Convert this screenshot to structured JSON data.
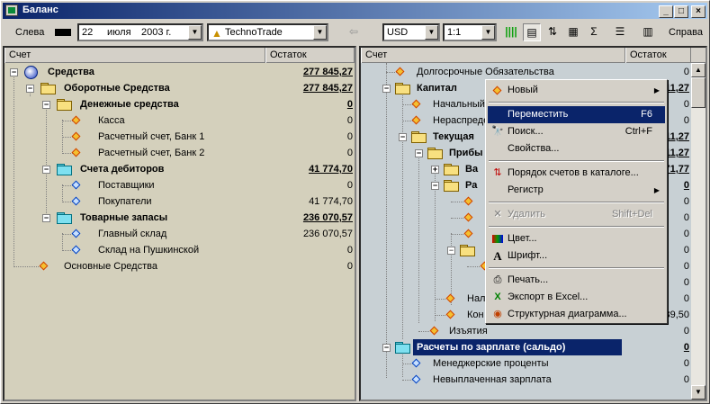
{
  "window": {
    "title": "Баланс"
  },
  "toolbar": {
    "left_label": "Слева",
    "right_label": "Справа",
    "date_day": "22",
    "date_month": "июля",
    "date_year": "2003 г.",
    "company": "TechnoTrade",
    "currency": "USD",
    "scale": "1:1",
    "back_arrow": "⇦"
  },
  "left": {
    "col_account": "Счет",
    "col_balance": "Остаток",
    "rows": [
      {
        "label": "Средства",
        "amount": "277 845,27"
      },
      {
        "label": "Оборотные Средства",
        "amount": "277 845,27"
      },
      {
        "label": "Денежные средства",
        "amount": "0"
      },
      {
        "label": "Касса",
        "amount": "0"
      },
      {
        "label": "Расчетный счет, Банк 1",
        "amount": "0"
      },
      {
        "label": "Расчетный счет, Банк 2",
        "amount": "0"
      },
      {
        "label": "Счета дебиторов",
        "amount": "41 774,70"
      },
      {
        "label": "Поставщики",
        "amount": "0"
      },
      {
        "label": "Покупатели",
        "amount": "41 774,70"
      },
      {
        "label": "Товарные запасы",
        "amount": "236 070,57"
      },
      {
        "label": "Главный склад",
        "amount": "236 070,57"
      },
      {
        "label": "Склад на Пушкинской",
        "amount": "0"
      },
      {
        "label": "Основные Средства",
        "amount": "0"
      }
    ]
  },
  "right": {
    "col_account": "Счет",
    "col_balance": "Остаток",
    "rows": [
      {
        "label": "Долгосрочные Обязательства",
        "amount": "0"
      },
      {
        "label": "Капитал",
        "amount": "11,27"
      },
      {
        "label": "Начальный",
        "amount": "0"
      },
      {
        "label": "Нераспреде",
        "amount": "0"
      },
      {
        "label": "Текущая",
        "amount": "11,27"
      },
      {
        "label": "Прибы",
        "amount": "11,27"
      },
      {
        "label": "Ва",
        "amount": "71,77"
      },
      {
        "label": "Ра",
        "amount": "0"
      },
      {
        "label": "",
        "amount": "0"
      },
      {
        "label": "",
        "amount": "0"
      },
      {
        "label": "",
        "amount": "0"
      },
      {
        "label": "",
        "amount": "0"
      },
      {
        "label": "",
        "amount": "0"
      },
      {
        "label": "",
        "amount": "0"
      },
      {
        "label": "Нал",
        "amount": "0"
      },
      {
        "label": "Кон",
        "amount": "39,50"
      },
      {
        "label": "Изъятия",
        "amount": "0"
      },
      {
        "label": "Расчеты по зарплате (сальдо)",
        "amount": "0"
      },
      {
        "label": "Менеджерские проценты",
        "amount": "0"
      },
      {
        "label": "Невыплаченная зарплата",
        "amount": "0"
      }
    ]
  },
  "context_menu": {
    "items": [
      {
        "label": "Новый",
        "shortcut": "",
        "submenu": "▶"
      },
      {
        "label": "Переместить",
        "shortcut": "F6"
      },
      {
        "label": "Поиск...",
        "shortcut": "Ctrl+F"
      },
      {
        "label": "Свойства...",
        "shortcut": ""
      },
      {
        "label": "Порядок счетов в каталоге...",
        "shortcut": ""
      },
      {
        "label": "Регистр",
        "shortcut": "",
        "submenu": "▶"
      },
      {
        "label": "Удалить",
        "shortcut": "Shift+Del"
      },
      {
        "label": "Цвет...",
        "shortcut": ""
      },
      {
        "label": "Шрифт...",
        "shortcut": ""
      },
      {
        "label": "Печать...",
        "shortcut": ""
      },
      {
        "label": "Экспорт в Excel...",
        "shortcut": ""
      },
      {
        "label": "Структурная диаграмма...",
        "shortcut": ""
      }
    ]
  }
}
